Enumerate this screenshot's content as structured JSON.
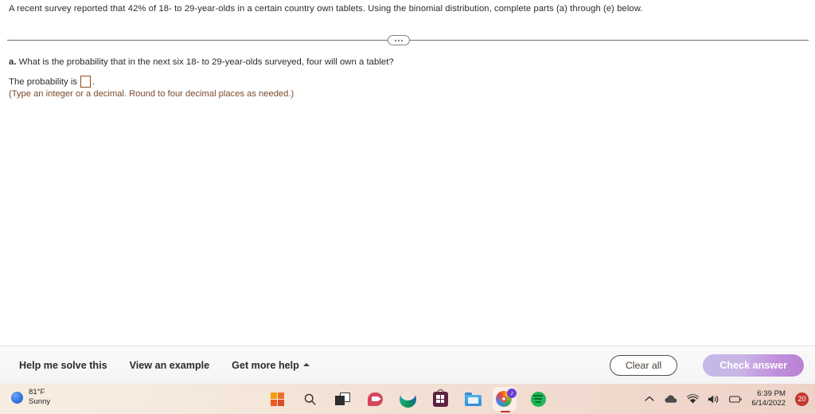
{
  "exercise": {
    "problem_statement": "A recent survey reported that 42% of 18- to 29-year-olds in a certain country own tablets. Using the binomial distribution, complete parts (a) through (e) below.",
    "part_label": "a.",
    "part_question": "What is the probability that in the next six 18- to 29-year-olds surveyed, four will own a tablet?",
    "answer_label": "The probability is",
    "answer_value": "",
    "answer_period": ".",
    "answer_hint": "(Type an integer or a decimal. Round to four decimal places as needed.)",
    "collapse_handle": "ellipsis-handle"
  },
  "toolbar": {
    "help_solve": "Help me solve this",
    "view_example": "View an example",
    "get_more_help": "Get more help",
    "clear_all": "Clear all",
    "check_answer": "Check answer",
    "check_answer_color": "#bb7fd4"
  },
  "taskbar": {
    "weather": {
      "temperature": "81°F",
      "condition": "Sunny",
      "icon": "weather-sun-icon"
    },
    "apps": [
      {
        "name": "start-button",
        "icon": "windows-logo-icon"
      },
      {
        "name": "search-button",
        "icon": "search-icon"
      },
      {
        "name": "task-view-button",
        "icon": "task-view-icon"
      },
      {
        "name": "chat-button",
        "icon": "chat-icon"
      },
      {
        "name": "edge-button",
        "icon": "edge-icon"
      },
      {
        "name": "microsoft-store-button",
        "icon": "store-icon"
      },
      {
        "name": "file-explorer-button",
        "icon": "folder-icon"
      },
      {
        "name": "chrome-button",
        "icon": "chrome-icon",
        "badge": "♪",
        "active": true
      },
      {
        "name": "spotify-button",
        "icon": "spotify-icon"
      }
    ],
    "tray": {
      "show_hidden": "chevron-up-icon",
      "onedrive": "cloud-icon",
      "network": "wifi-icon",
      "volume": "speaker-icon",
      "battery": "battery-icon",
      "time": "6:39 PM",
      "date": "6/14/2022",
      "notification_count": "20",
      "notification_color": "#c2372f"
    }
  }
}
